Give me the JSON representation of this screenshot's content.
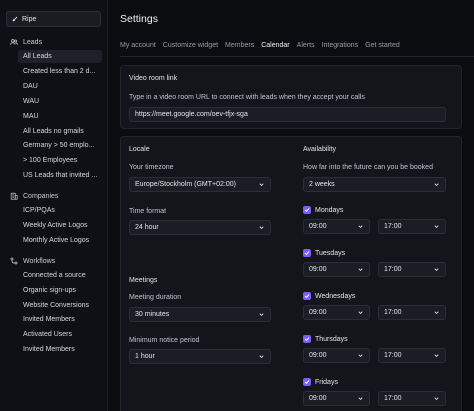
{
  "sidebar": {
    "workspace": "Ripe",
    "leads_header": "Leads",
    "leads": [
      "All Leads",
      "Created less than 2 d...",
      "DAU",
      "WAU",
      "MAU",
      "All Leads no gmails",
      "Germany > 50 emplo...",
      "> 100 Employees",
      "US Leads that invited ..."
    ],
    "companies_header": "Companies",
    "companies": [
      "ICP/PQAs",
      "Weekly Active Logos",
      "Monthly Active Logos"
    ],
    "workflows_header": "Workflows",
    "workflows": [
      "Connected a source",
      "Organic sign-ups",
      "Website Conversions",
      "Invited Members",
      "Activated Users",
      "Invited Members"
    ]
  },
  "header": {
    "title": "Settings",
    "tabs": [
      "My account",
      "Customize widget",
      "Members",
      "Calendar",
      "Alerts",
      "Integrations",
      "Get started"
    ],
    "active_tab": "Calendar"
  },
  "video": {
    "title": "Video room link",
    "description": "Type in a video room URL to connect with leads when they accept your calls",
    "value": "https://meet.google.com/oev-tfjx-sga"
  },
  "locale": {
    "title": "Locale",
    "timezone_label": "Your timezone",
    "timezone_value": "Europe/Stockholm (GMT+02:00)",
    "time_format_label": "Time format",
    "time_format_value": "24 hour"
  },
  "meetings": {
    "title": "Meetings",
    "duration_label": "Meeting duration",
    "duration_value": "30 minutes",
    "notice_label": "Minimum notice period",
    "notice_value": "1 hour"
  },
  "availability": {
    "title": "Availability",
    "horizon_label": "How far into the future can you be booked",
    "horizon_value": "2 weeks",
    "days": [
      {
        "name": "Mondays",
        "checked": true,
        "start": "09:00",
        "end": "17:00"
      },
      {
        "name": "Tuesdays",
        "checked": true,
        "start": "09:00",
        "end": "17:00"
      },
      {
        "name": "Wednesdays",
        "checked": true,
        "start": "09:00",
        "end": "17:00"
      },
      {
        "name": "Thursdays",
        "checked": true,
        "start": "09:00",
        "end": "17:00"
      },
      {
        "name": "Fridays",
        "checked": true,
        "start": "09:00",
        "end": "17:00"
      }
    ]
  },
  "colors": {
    "accent": "#7c5cff",
    "background": "#0b0c10",
    "card": "#13151b"
  }
}
